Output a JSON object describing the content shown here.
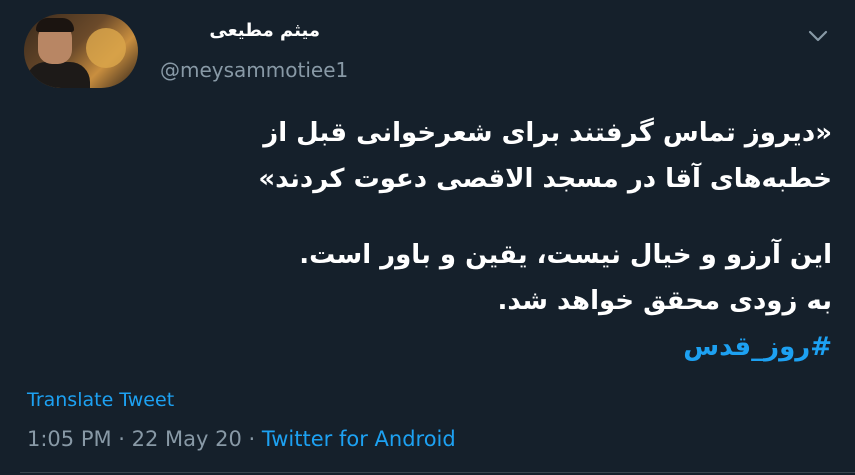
{
  "author": {
    "display_name": "میثم مطیعی",
    "handle": "@meysammotiee1"
  },
  "tweet": {
    "lines_block1": [
      "«دیروز تماس گرفتند برای شعرخوانی قبل از",
      "خطبه‌های آقا در مسجد الاقصی دعوت کردند»"
    ],
    "lines_block2": [
      "این آرزو و خیال نیست، یقین و باور است.",
      "به زودی محقق خواهد شد."
    ],
    "hashtag": "#روز_قدس"
  },
  "translate_label": "Translate Tweet",
  "meta": {
    "time": "1:05 PM",
    "separator": " · ",
    "date": "22 May 20",
    "source": "Twitter for Android"
  },
  "colors": {
    "background": "#15202b",
    "accent": "#1da1f2",
    "secondary_text": "#8899a6"
  },
  "icons": {
    "chevron": "chevron-down-icon"
  }
}
